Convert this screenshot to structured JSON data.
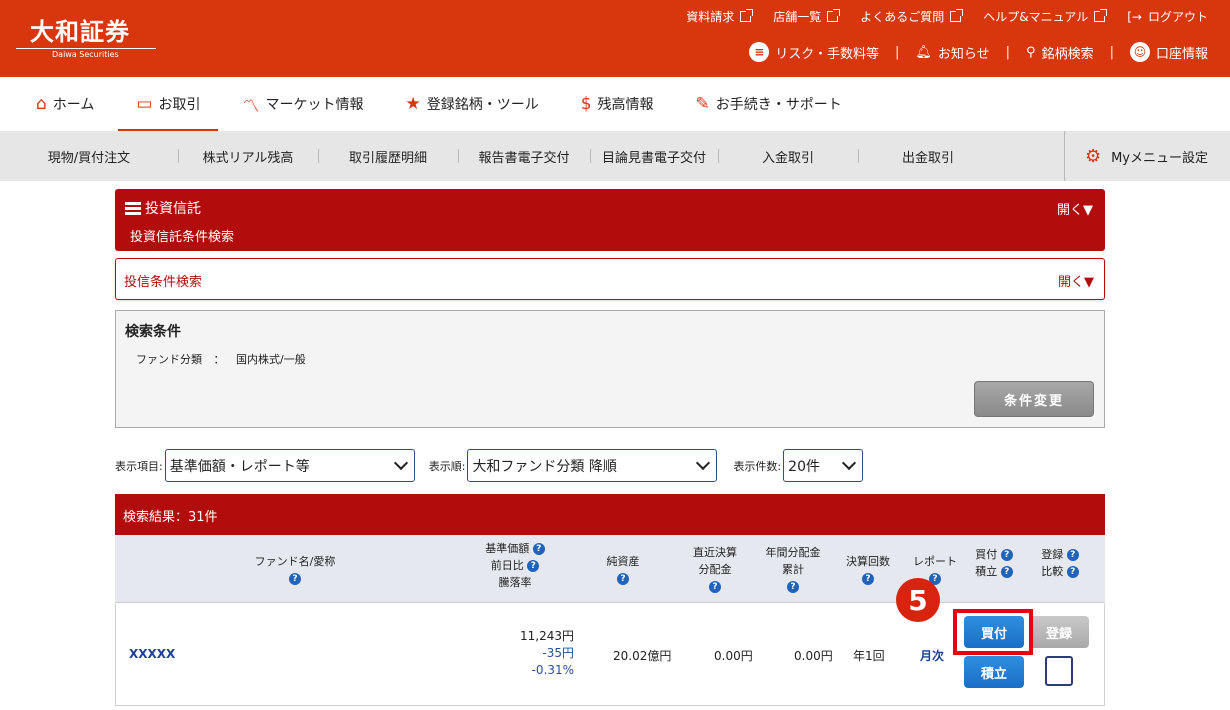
{
  "header": {
    "logo_text": "大和証券",
    "logo_sub": "Daiwa Securities",
    "top_links": [
      "資料請求",
      "店舗一覧",
      "よくあるご質問",
      "ヘルプ&マニュアル"
    ],
    "logout": "ログアウト",
    "risk": "リスク・手数料等",
    "notice": "お知らせ",
    "search": "銘柄検索",
    "account": "口座情報"
  },
  "nav": {
    "home": "ホーム",
    "trade": "お取引",
    "market": "マーケット情報",
    "tools": "登録銘柄・ツール",
    "balance": "残高情報",
    "procedures": "お手続き・サポート"
  },
  "subnav": {
    "items": [
      "現物/買付注文",
      "株式リアル残高",
      "取引履歴明細",
      "報告書電子交付",
      "目論見書電子交付",
      "入金取引",
      "出金取引"
    ],
    "my_menu": "Myメニュー設定"
  },
  "section": {
    "title": "投資信託",
    "subtitle": "投資信託条件検索",
    "open": "開く▼",
    "search_bar": "投信条件検索",
    "search_open": "開く▼"
  },
  "conditions": {
    "title": "検索条件",
    "fund_class_label": "ファンド分類",
    "fund_class_sep": "：",
    "fund_class_value": "国内株式/一般",
    "change_button": "条件変更"
  },
  "filters": {
    "display_items_label": "表示項目:",
    "display_items_value": "基準価額・レポート等",
    "order_label": "表示順:",
    "order_value": "大和ファンド分類 降順",
    "count_label": "表示件数:",
    "count_value": "20件"
  },
  "results": {
    "header": "検索結果：31件",
    "columns": {
      "fund_name": "ファンド名/愛称",
      "nav1": "基準価額",
      "nav2": "前日比",
      "nav3": "騰落率",
      "assets": "純資産",
      "dist1": "直近決算",
      "dist2": "分配金",
      "annual1": "年間分配金",
      "annual2": "累計",
      "settlements": "決算回数",
      "report": "レポート",
      "buy": "買付",
      "accum": "積立",
      "register": "登録",
      "compare": "比較"
    },
    "rows": [
      {
        "name": "XXXXX",
        "nav": "11,243円",
        "change": "-35円",
        "rate": "-0.31%",
        "assets": "20.02億円",
        "dist": "0.00円",
        "annual": "0.00円",
        "settlements": "年1回",
        "report": "月次",
        "buy_label": "買付",
        "accum_label": "積立",
        "register_label": "登録"
      }
    ]
  },
  "step_number": "5",
  "colors": {
    "brand": "#d8370d",
    "section": "#b30c0c",
    "button_blue": "#1a6fc5",
    "highlight": "#e60012"
  }
}
